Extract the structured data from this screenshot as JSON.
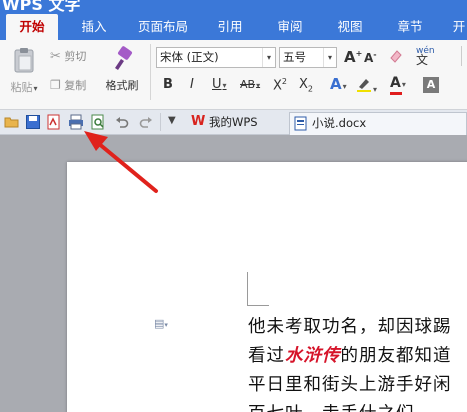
{
  "app": {
    "title": "WPS 文字"
  },
  "ribbon_tabs": [
    {
      "label": "开始",
      "active": true
    },
    {
      "label": "插入"
    },
    {
      "label": "页面布局"
    },
    {
      "label": "引用"
    },
    {
      "label": "审阅"
    },
    {
      "label": "视图"
    },
    {
      "label": "章节"
    },
    {
      "label": "开"
    }
  ],
  "clipboard": {
    "paste_label": "粘贴",
    "cut_label": "剪切",
    "copy_label": "复制",
    "format_painter_label": "格式刷"
  },
  "font": {
    "family": "宋体 (正文)",
    "size": "五号"
  },
  "quickbar": {
    "tabs": [
      {
        "label": "我的WPS",
        "active": false
      },
      {
        "label": "小说.docx",
        "active": true
      }
    ]
  },
  "document": {
    "line1": "他未考取功名，却因球踢",
    "line2_before": "看过",
    "line2_highlight": "水浒传",
    "line2_after": "的朋友都知道",
    "line3": "平日里和街头上游手好闲",
    "line4": "百七叶，走手什之们"
  },
  "colors": {
    "ribbon_blue": "#3b78d8",
    "active_tab_text": "#c00000",
    "highlight_text": "#d6142a",
    "annotation_arrow": "#e0221c"
  }
}
